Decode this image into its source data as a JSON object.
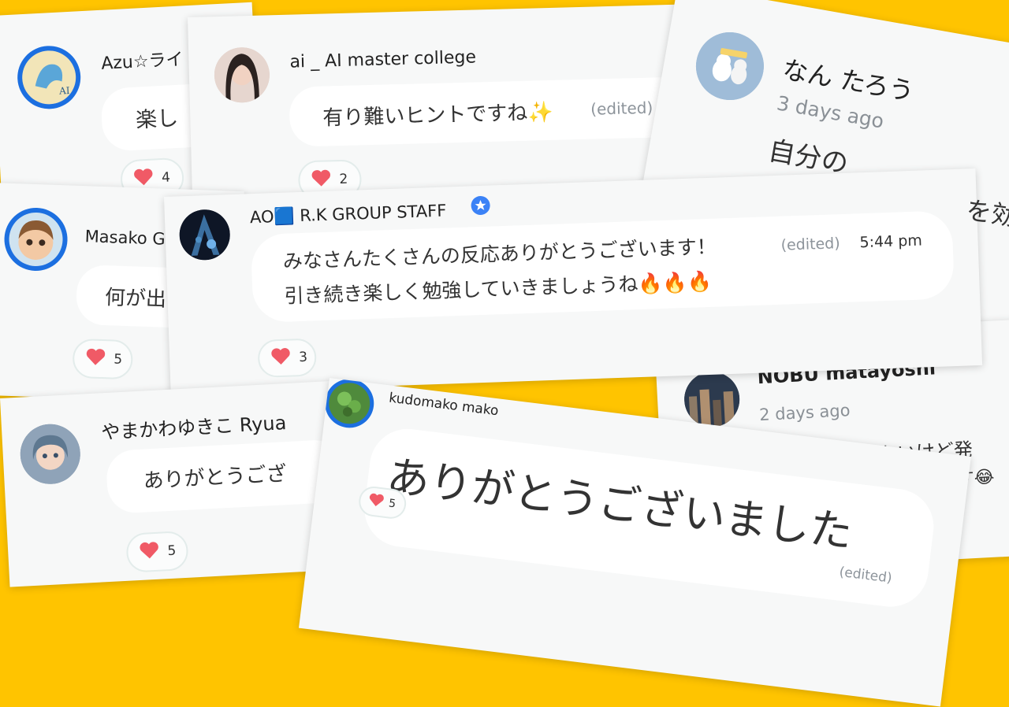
{
  "colors": {
    "background": "#ffc400",
    "card": "#f7f8f8",
    "bubble": "#ffffff",
    "heart": "#f05a66",
    "verified": "#3b82f6",
    "avatar_ring": "#1c6fe0"
  },
  "comments": [
    {
      "user": "Azu☆ライ",
      "text": "楽し",
      "reactions": "4"
    },
    {
      "user": "ai _ AI master college",
      "text": "有り難いヒントですね✨",
      "edited": "(edited)",
      "reactions": "2"
    },
    {
      "user": "なん たろう",
      "time": "3 days ago",
      "text": "自分の",
      "extra": "を効"
    },
    {
      "user": "Masako G",
      "text": "何が出",
      "reactions": "5"
    },
    {
      "user": "AO🟦 R.K GROUP STAFF",
      "badge": "verified-icon",
      "line1": "みなさんたくさんの反応ありがとうございます！",
      "line2": "引き続き楽しく勉強していきましょうね🔥🔥🔥",
      "edited": "(edited)",
      "time": "5:44 pm",
      "reactions": "3"
    },
    {
      "user": "NOBU matayoshi",
      "time": "2 days ago",
      "line1": "もわからないけど発",
      "line2": "ます😂"
    },
    {
      "user": "やまかわゆきこ Ryua",
      "text": "ありがとうござ",
      "reactions": "5"
    },
    {
      "user": "kudomako mako",
      "text": "ありがとうございました",
      "edited": "(edited)",
      "reactions": "5"
    }
  ]
}
